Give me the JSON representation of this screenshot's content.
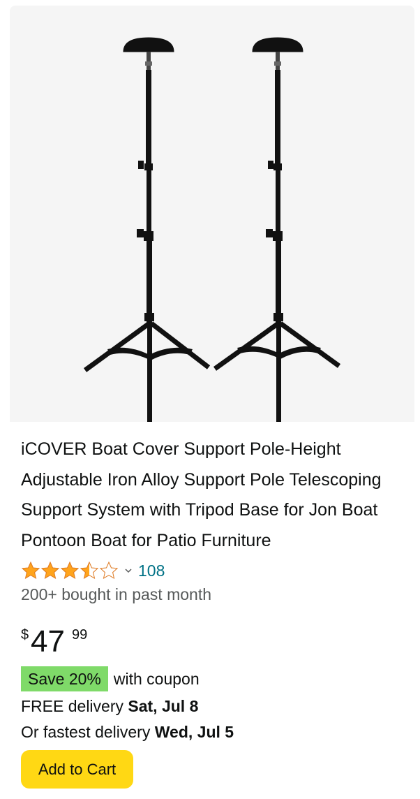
{
  "product": {
    "title": "iCOVER Boat Cover Support Pole-Height Adjustable Iron Alloy Support Pole Telescoping Support System with Tripod Base for Jon Boat Pontoon Boat for Patio Furniture",
    "image_icon": "product-image",
    "rating": 3.5,
    "review_count": "108",
    "bought_text": "200+ bought in past month",
    "price": {
      "symbol": "$",
      "whole": "47",
      "fraction": "99"
    },
    "coupon": {
      "badge": "Save 20%",
      "text": "with coupon"
    },
    "delivery": {
      "free_prefix": "FREE delivery ",
      "free_date": "Sat, Jul 8",
      "fast_prefix": "Or fastest delivery ",
      "fast_date": "Wed, Jul 5"
    },
    "add_to_cart_label": "Add to Cart"
  },
  "colors": {
    "star": "#ffa41c",
    "link": "#007185",
    "badge": "#7fda69",
    "button": "#ffd814",
    "image_bg": "#f5f5f5"
  }
}
